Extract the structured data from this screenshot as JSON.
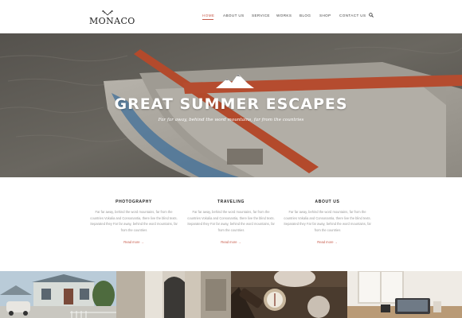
{
  "brand": {
    "name": "MONACO",
    "logo_icon": "antlers-icon"
  },
  "nav": {
    "items": [
      {
        "label": "HOME",
        "active": true
      },
      {
        "label": "ABOUT US",
        "active": false
      },
      {
        "label": "SERVICE",
        "active": false
      },
      {
        "label": "WORKS",
        "active": false
      },
      {
        "label": "BLOG",
        "active": false
      },
      {
        "label": "SHOP",
        "active": false
      },
      {
        "label": "CONTACT US",
        "active": false
      }
    ],
    "search_icon": "search-icon"
  },
  "hero": {
    "icon": "mountain-icon",
    "title": "GREAT SUMMER ESCAPES",
    "subtitle": "Far far away, behind the word mountains, far from the countries"
  },
  "features": [
    {
      "title": "PHOTOGRAPHY",
      "text": "Far far away, behind the word mountains, far from the countries Vokalia and Consonantia, there live the blind texts. Separated they Far far away, behind the word mountains, far from the countries",
      "link": "Read more →"
    },
    {
      "title": "TRAVELING",
      "text": "Far far away, behind the word mountains, far from the countries Vokalia and Consonantia, there live the blind texts. Separated they Far far away, behind the word mountains, far from the countries",
      "link": "Read more →"
    },
    {
      "title": "ABOUT US",
      "text": "Far far away, behind the word mountains, far from the countries Vokalia and Consonantia, there live the blind texts. Separated they Far far away, behind the word mountains, far from the countries",
      "link": "Read more →"
    }
  ],
  "gallery": [
    {
      "name": "house-photo"
    },
    {
      "name": "doorway-photo"
    },
    {
      "name": "compass-photo"
    },
    {
      "name": "desk-photo"
    }
  ],
  "colors": {
    "accent": "#c65a4a",
    "text": "#222222",
    "muted": "#9a9a9a"
  }
}
